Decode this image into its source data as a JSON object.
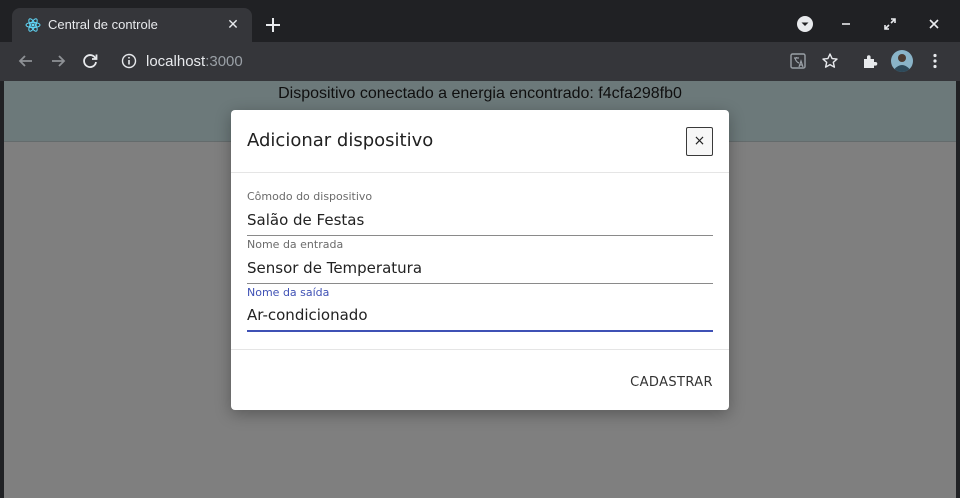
{
  "browser": {
    "tab": {
      "title": "Central de controle",
      "favicon": "react-icon",
      "close_symbol": "✕"
    },
    "new_tab_icon": "plus-icon",
    "window_controls": [
      "profile-dropdown-icon",
      "minimize-icon",
      "restore-icon",
      "close-icon"
    ],
    "address": {
      "host": "localhost",
      "port": ":3000"
    },
    "toolbar_icons": [
      "back-icon",
      "forward-icon",
      "reload-icon",
      "info-icon",
      "translate-icon",
      "star-icon",
      "extensions-icon",
      "avatar",
      "menu-icon"
    ]
  },
  "page": {
    "banner_text": "Dispositivo conectado a energia encontrado: f4cfa298fb0"
  },
  "modal": {
    "title": "Adicionar dispositivo",
    "close_symbol": "×",
    "fields": [
      {
        "label": "Cômodo do dispositivo",
        "value": "Salão de Festas"
      },
      {
        "label": "Nome da entrada",
        "value": "Sensor de Temperatura"
      },
      {
        "label": "Nome da saída",
        "value": "Ar-condicionado",
        "focused": true
      }
    ],
    "submit_label": "CADASTRAR"
  },
  "colors": {
    "chrome_dark": "#202124",
    "toolbar": "#35363a",
    "banner_bg": "#d9f2f5",
    "focus_accent": "#3f51b5"
  }
}
